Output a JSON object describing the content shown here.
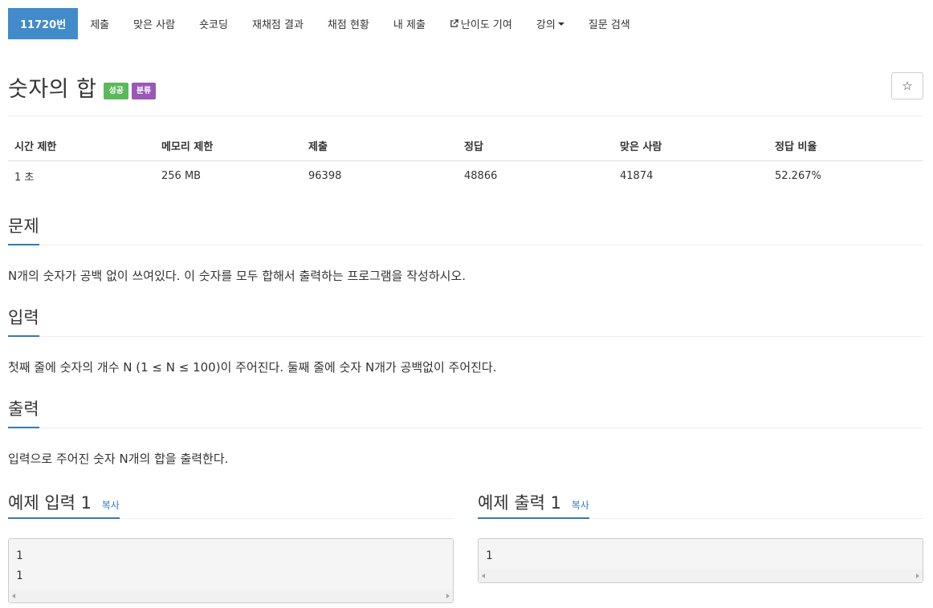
{
  "nav": {
    "items": [
      {
        "label": "11720번",
        "active": true
      },
      {
        "label": "제출"
      },
      {
        "label": "맞은 사람"
      },
      {
        "label": "숏코딩"
      },
      {
        "label": "재채점 결과"
      },
      {
        "label": "채점 현황"
      },
      {
        "label": "내 제출"
      },
      {
        "label": "난이도 기여",
        "icon": "external-link-icon"
      },
      {
        "label": "강의",
        "dropdown": true
      },
      {
        "label": "질문 검색"
      }
    ]
  },
  "problem": {
    "title": "숫자의 합",
    "badges": {
      "success": "성공",
      "category": "분류"
    },
    "star_icon": "☆"
  },
  "info": {
    "headers": [
      "시간 제한",
      "메모리 제한",
      "제출",
      "정답",
      "맞은 사람",
      "정답 비율"
    ],
    "values": [
      "1 초",
      "256 MB",
      "96398",
      "48866",
      "41874",
      "52.267%"
    ]
  },
  "sections": {
    "description": {
      "heading": "문제",
      "text": "N개의 숫자가 공백 없이 쓰여있다. 이 숫자를 모두 합해서 출력하는 프로그램을 작성하시오."
    },
    "input": {
      "heading": "입력",
      "text": "첫째 줄에 숫자의 개수 N (1 ≤ N ≤ 100)이 주어진다. 둘째 줄에 숫자 N개가 공백없이 주어진다."
    },
    "output": {
      "heading": "출력",
      "text": "입력으로 주어진 숫자 N개의 합을 출력한다."
    }
  },
  "samples": {
    "copy_label": "복사",
    "input": {
      "heading": "예제 입력 1",
      "content": "1\n1"
    },
    "output": {
      "heading": "예제 출력 1",
      "content": "1"
    }
  },
  "colors": {
    "nav_active": "#428bca",
    "badge_success": "#5cb85c",
    "badge_category": "#9b59b6",
    "accent": "#337ab7"
  }
}
